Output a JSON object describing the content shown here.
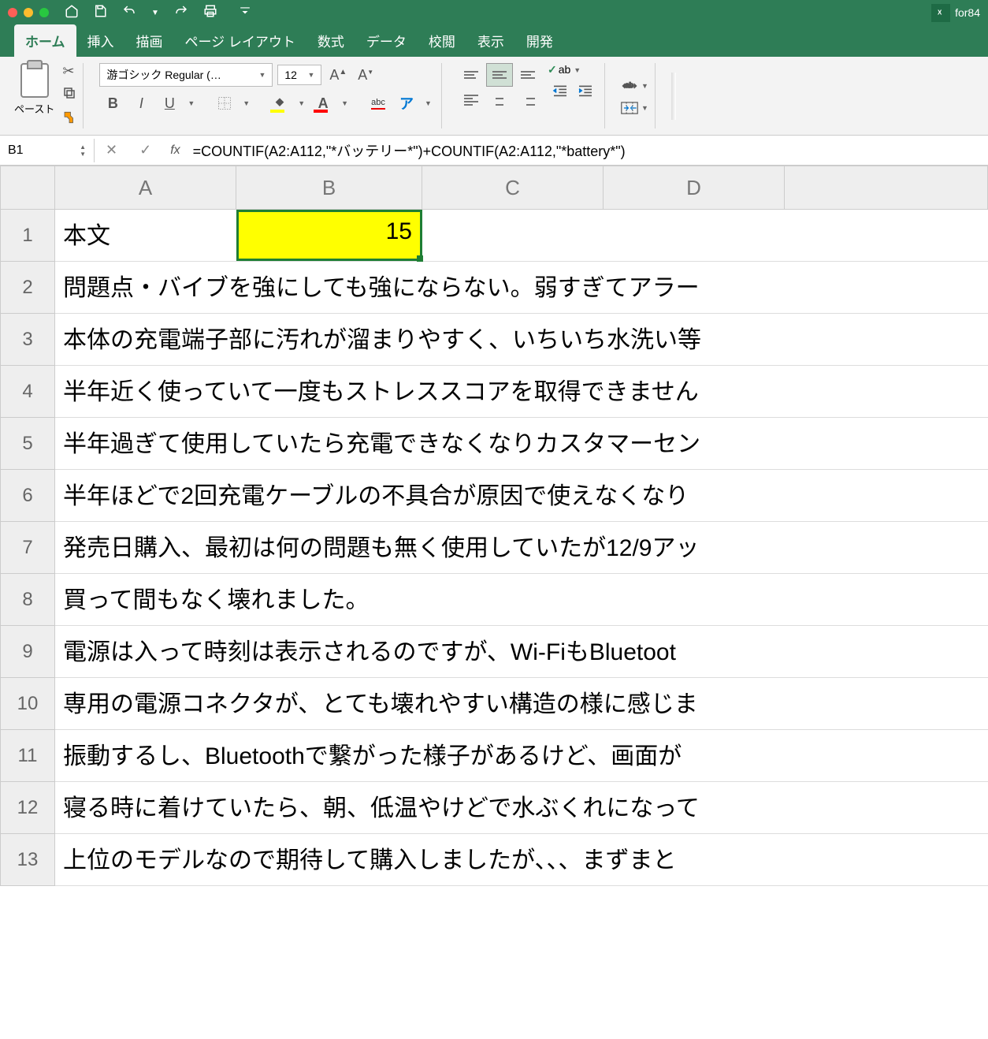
{
  "titlebar": {
    "doc_name": "for84"
  },
  "tabs": {
    "home": "ホーム",
    "insert": "挿入",
    "draw": "描画",
    "page_layout": "ページ レイアウト",
    "formulas": "数式",
    "data": "データ",
    "review": "校閲",
    "view": "表示",
    "developer": "開発"
  },
  "ribbon": {
    "paste": "ペースト",
    "font_name": "游ゴシック Regular (…",
    "font_size": "12",
    "abc": "abc"
  },
  "formula_bar": {
    "name_box": "B1",
    "fx": "fx",
    "formula": "=COUNTIF(A2:A112,\"*バッテリー*\")+COUNTIF(A2:A112,\"*battery*\")"
  },
  "columns": {
    "A": "A",
    "B": "B",
    "C": "C",
    "D": "D"
  },
  "rows": [
    "1",
    "2",
    "3",
    "4",
    "5",
    "6",
    "7",
    "8",
    "9",
    "10",
    "11",
    "12",
    "13"
  ],
  "cells": {
    "A1": "本文",
    "B1": "15",
    "A2": "問題点・バイブを強にしても強にならない。弱すぎてアラー",
    "A3": "本体の充電端子部に汚れが溜まりやすく、いちいち水洗い等",
    "A4": "半年近く使っていて一度もストレススコアを取得できません",
    "A5": "半年過ぎて使用していたら充電できなくなりカスタマーセン",
    "A6": "半年ほどで2回充電ケーブルの不具合が原因で使えなくなり",
    "A7": "発売日購入、最初は何の問題も無く使用していたが12/9アッ",
    "A8": "買って間もなく壊れました。",
    "A9": "電源は入って時刻は表示されるのですが、Wi-FiもBluetoot",
    "A10": "専用の電源コネクタが、とても壊れやすい構造の様に感じま",
    "A11": "振動するし、Bluetoothで繋がった様子があるけど、画面が",
    "A12": "寝る時に着けていたら、朝、低温やけどで水ぶくれになって",
    "A13": "上位のモデルなので期待して購入しましたが、、、まずまと"
  }
}
